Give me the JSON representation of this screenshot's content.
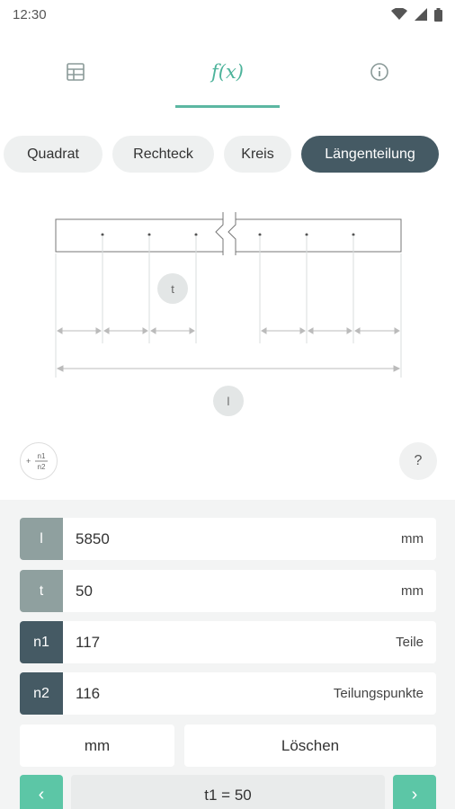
{
  "status": {
    "time": "12:30"
  },
  "tabs": [
    {
      "id": "table",
      "icon": "table-icon"
    },
    {
      "id": "formula",
      "label": "f(x)",
      "active": true
    },
    {
      "id": "info",
      "icon": "info-icon"
    }
  ],
  "chips": [
    "Quadrat",
    "Rechteck",
    "Kreis",
    "Längenteilung"
  ],
  "active_chip": "Längenteilung",
  "diagram": {
    "t_label": "t",
    "l_label": "l"
  },
  "fraction_button": {
    "text": "+ n1/n2"
  },
  "help_button": {
    "text": "?"
  },
  "fields": [
    {
      "label": "l",
      "value": "5850",
      "unit": "mm",
      "style": "light"
    },
    {
      "label": "t",
      "value": "50",
      "unit": "mm",
      "style": "light"
    },
    {
      "label": "n1",
      "value": "117",
      "unit": "Teile",
      "style": "dark"
    },
    {
      "label": "n2",
      "value": "116",
      "unit": "Teilungspunkte",
      "style": "dark"
    }
  ],
  "buttons": {
    "unit": "mm",
    "clear": "Löschen"
  },
  "nav": {
    "prev": "‹",
    "next": "›",
    "value": "t1 = 50"
  },
  "colors": {
    "accent": "#5cc6a6",
    "dark": "#455a64",
    "light": "#8fa09f"
  }
}
